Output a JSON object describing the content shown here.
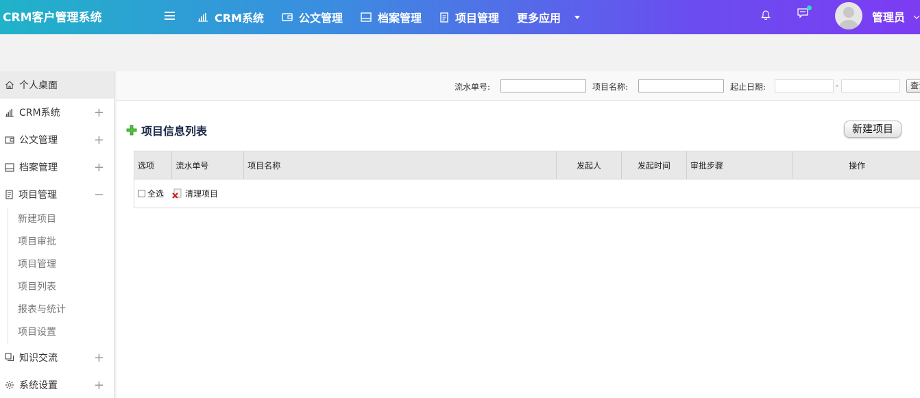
{
  "app": {
    "title": "CRM客户管理系统"
  },
  "nav": [
    {
      "label": "CRM系统",
      "icon": "bar-chart-icon"
    },
    {
      "label": "公文管理",
      "icon": "wallet-icon"
    },
    {
      "label": "档案管理",
      "icon": "archive-icon"
    },
    {
      "label": "项目管理",
      "icon": "document-icon"
    },
    {
      "label": "更多应用",
      "icon": "caret-down-icon"
    }
  ],
  "user": {
    "name": "管理员"
  },
  "sidebar": {
    "items": [
      {
        "label": "个人桌面"
      },
      {
        "label": "CRM系统",
        "toggle": "+"
      },
      {
        "label": "公文管理",
        "toggle": "+"
      },
      {
        "label": "档案管理",
        "toggle": "+"
      },
      {
        "label": "项目管理",
        "toggle": "−"
      },
      {
        "label": "知识交流",
        "toggle": "+"
      },
      {
        "label": "系统设置",
        "toggle": "+"
      }
    ],
    "sub_items": [
      "新建项目",
      "项目审批",
      "项目管理",
      "项目列表",
      "报表与统计",
      "项目设置"
    ]
  },
  "search": {
    "serial_label": "流水单号:",
    "name_label": "项目名称:",
    "date_label": "起止日期:",
    "date_sep": "-",
    "button_label": "查询"
  },
  "list": {
    "title": "项目信息列表",
    "new_button": "新建项目",
    "columns": [
      "选项",
      "流水单号",
      "项目名称",
      "发起人",
      "发起时间",
      "审批步骤",
      "操作"
    ],
    "select_all": "全选",
    "clear_label": "清理项目"
  },
  "colors": {
    "header_start": "#20b2c8",
    "header_end": "#7c3cf2"
  }
}
